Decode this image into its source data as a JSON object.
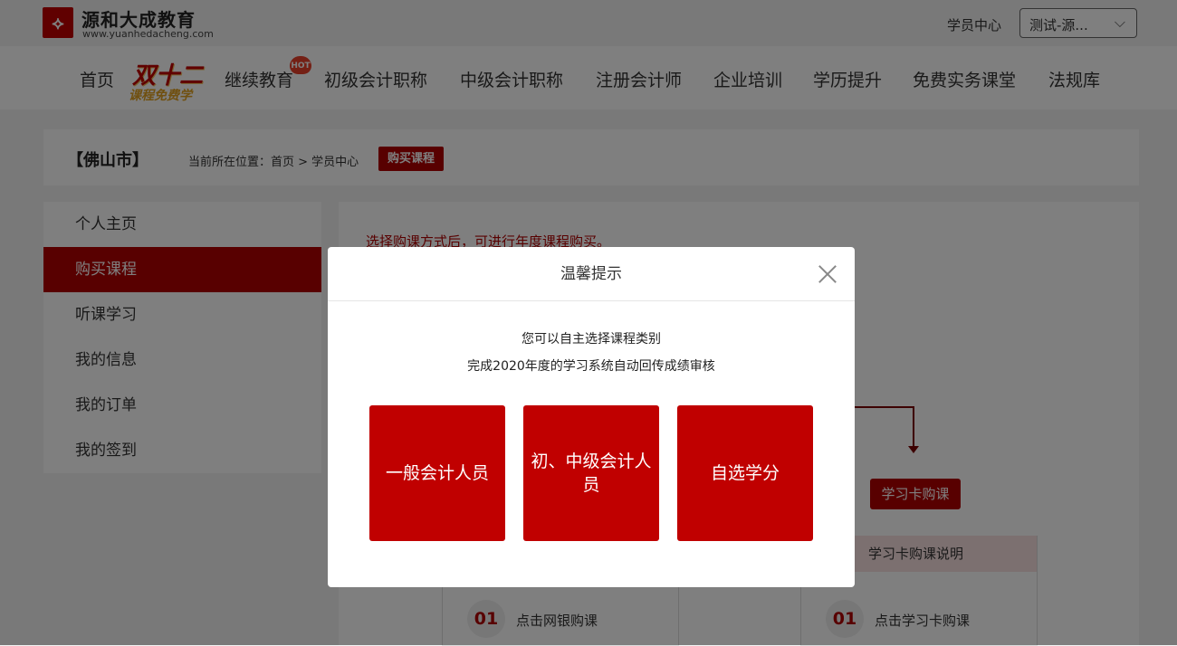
{
  "header": {
    "brand_name": "源和大成教育",
    "brand_url": "www.yuanhedacheng.com",
    "student_center": "学员中心",
    "user_select": "测试-源..."
  },
  "nav": {
    "items": [
      "首页",
      "继续教育",
      "初级会计职称",
      "中级会计职称",
      "注册会计师",
      "企业培训",
      "学历提升",
      "免费实务课堂",
      "法规库"
    ],
    "promo_line1": "双十二",
    "promo_line2": "课程免费学",
    "hot_badge": "HOT"
  },
  "breadcrumb": {
    "city": "【佛山市】",
    "prefix": "当前所在位置：首页 > 学员中心",
    "current": "购买课程"
  },
  "sidebar": {
    "items": [
      {
        "label": "个人主页",
        "active": false
      },
      {
        "label": "购买课程",
        "active": true
      },
      {
        "label": "听课学习",
        "active": false
      },
      {
        "label": "我的信息",
        "active": false
      },
      {
        "label": "我的订单",
        "active": false
      },
      {
        "label": "我的签到",
        "active": false
      }
    ]
  },
  "main": {
    "note": "选择购课方式后，可进行年度课程购买。",
    "card_buy_button": "学习卡购课",
    "card_panel_title": "学习卡购课说明",
    "left_step": {
      "num": "01",
      "text": "点击网银购课"
    },
    "right_step": {
      "num": "01",
      "text": "点击学习卡购课"
    }
  },
  "modal": {
    "title": "温馨提示",
    "line1": "您可以自主选择课程类别",
    "line2": "完成2020年度的学习系统自动回传成绩审核",
    "choices": [
      "一般会计人员",
      "初、中级会计人员",
      "自选学分"
    ]
  },
  "colors": {
    "brand_red": "#c00000",
    "active_red": "#b00000"
  }
}
